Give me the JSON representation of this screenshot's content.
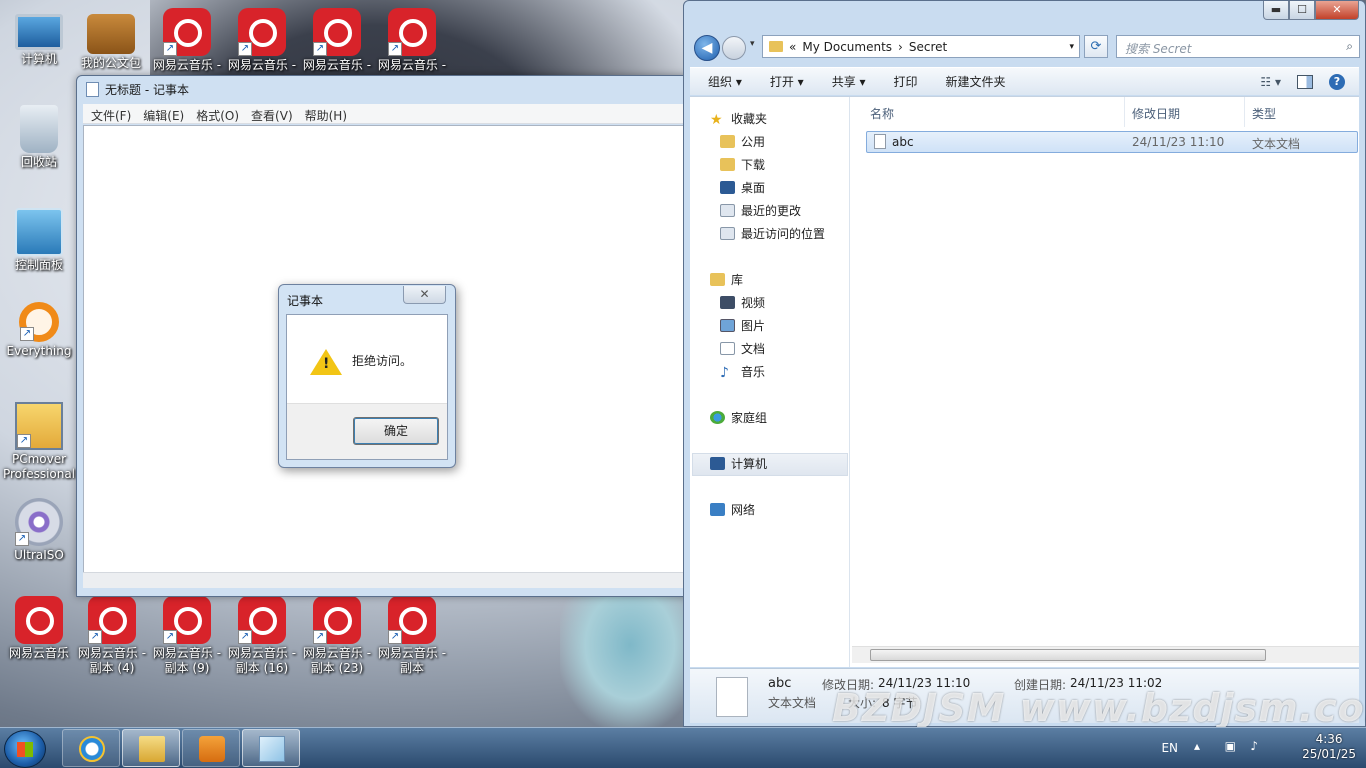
{
  "desktop": {
    "icons": [
      {
        "label": "计算机",
        "icon": "computer-icon"
      },
      {
        "label": "我的公文包",
        "icon": "briefcase-icon"
      },
      {
        "label": "网易云音乐 -",
        "icon": "netease-music-icon"
      },
      {
        "label": "网易云音乐 -",
        "icon": "netease-music-icon"
      },
      {
        "label": "网易云音乐 -",
        "icon": "netease-music-icon"
      },
      {
        "label": "网易云音乐 -",
        "icon": "netease-music-icon"
      },
      {
        "label": "回收站",
        "icon": "recycle-bin-icon"
      },
      {
        "label": "控制面板",
        "icon": "control-panel-icon"
      },
      {
        "label": "Everything",
        "icon": "everything-icon"
      },
      {
        "label": "PCmover Professional",
        "icon": "pcmover-icon"
      },
      {
        "label": "UltraISO",
        "icon": "ultraiso-icon"
      },
      {
        "label": "网易云音乐",
        "icon": "netease-music-icon"
      },
      {
        "label": "网易云音乐 - 副本 (4)",
        "icon": "netease-music-icon"
      },
      {
        "label": "网易云音乐 - 副本 (9)",
        "icon": "netease-music-icon"
      },
      {
        "label": "网易云音乐 - 副本 (16)",
        "icon": "netease-music-icon"
      },
      {
        "label": "网易云音乐 - 副本 (23)",
        "icon": "netease-music-icon"
      },
      {
        "label": "网易云音乐 - 副本",
        "icon": "netease-music-icon"
      }
    ]
  },
  "notepad": {
    "title": "无标题 - 记事本",
    "menu": [
      "文件(F)",
      "编辑(E)",
      "格式(O)",
      "查看(V)",
      "帮助(H)"
    ]
  },
  "dialog": {
    "title": "记事本",
    "close_glyph": "✕",
    "message": "拒绝访问。",
    "warning_glyph": "!",
    "ok_label": "确定"
  },
  "explorer": {
    "window_buttons": {
      "minimize": "▬",
      "maximize": "☐",
      "close": "✕"
    },
    "address": {
      "prefix": "«",
      "crumbs": [
        "My Documents",
        "Secret"
      ],
      "sep": "›"
    },
    "search_placeholder": "搜索 Secret",
    "toolbar": {
      "organize": "组织 ▾",
      "open": "打开 ▾",
      "share": "共享 ▾",
      "print": "打印",
      "new_folder": "新建文件夹",
      "help": "?"
    },
    "nav": {
      "favorites": "收藏夹",
      "fav_items": [
        "公用",
        "下载",
        "桌面",
        "最近的更改",
        "最近访问的位置"
      ],
      "libraries": "库",
      "lib_items": [
        "视频",
        "图片",
        "文档",
        "音乐"
      ],
      "homegroup": "家庭组",
      "computer": "计算机",
      "network": "网络"
    },
    "columns": {
      "name": "名称",
      "modified": "修改日期",
      "type": "类型"
    },
    "files": [
      {
        "name": "abc",
        "modified": "24/11/23 11:10",
        "type": "文本文档"
      }
    ],
    "details": {
      "name": "abc",
      "type": "文本文档",
      "modified_label": "修改日期:",
      "modified": "24/11/23 11:10",
      "created_label": "创建日期:",
      "created": "24/11/23 11:02",
      "size_label": "大小:",
      "size": "8 字节"
    }
  },
  "taskbar": {
    "lang": "EN",
    "time": "4:36",
    "date": "25/01/25"
  },
  "watermark": "BZDJSM www.bzdjsm.com",
  "colors": {
    "accent": "#3c7fb1",
    "netease_red": "#d8232a",
    "selection": "#cfe2f7"
  }
}
